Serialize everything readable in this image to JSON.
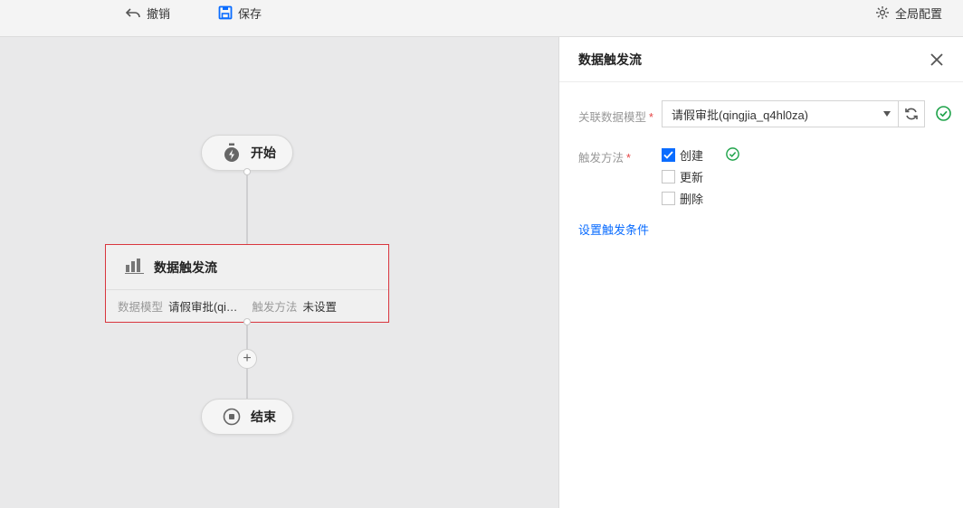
{
  "toolbar": {
    "undo_label": "撤销",
    "save_label": "保存",
    "config_label": "全局配置"
  },
  "canvas": {
    "start_label": "开始",
    "end_label": "结束",
    "node": {
      "title": "数据触发流",
      "model_key": "数据模型",
      "model_value": "请假审批(qi…",
      "method_key": "触发方法",
      "method_value": "未设置"
    },
    "add_symbol": "+"
  },
  "panel": {
    "title": "数据触发流",
    "model_label": "关联数据模型",
    "model_value": "请假审批(qingjia_q4hl0za)",
    "method_label": "触发方法",
    "required_mark": "*",
    "options": [
      {
        "label": "创建",
        "checked": true
      },
      {
        "label": "更新",
        "checked": false
      },
      {
        "label": "删除",
        "checked": false
      }
    ],
    "condition_link": "设置触发条件"
  },
  "colors": {
    "accent": "#0a6cff",
    "success": "#1fa34a",
    "node_border": "#d9363e",
    "required": "#e54545"
  }
}
